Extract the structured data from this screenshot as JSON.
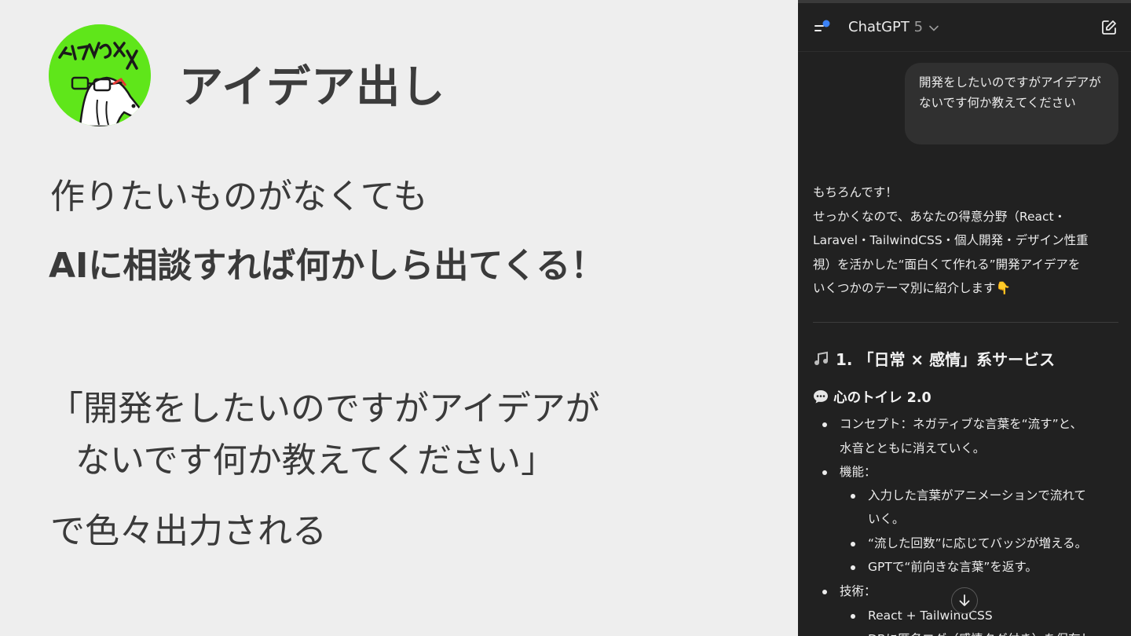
{
  "slide": {
    "title": "アイデア出し",
    "line1": "作りたいものがなくても",
    "line2": "AIに相談すれば何かしら出てくる！",
    "quote_line1": "「開発をしたいのですがアイデアが",
    "quote_line2": "ないです何か教えてください」",
    "line3": "で色々出力される",
    "avatar_icon": "horse-mascot-avatar",
    "avatar_lettering": "ケイタMAX",
    "accent": "#5fe61a"
  },
  "chat": {
    "header": {
      "model": "ChatGPT",
      "version": "5",
      "sidebar_icon": "sidebar-toggle-icon",
      "edit_icon": "new-chat-icon"
    },
    "user_message": "開発をしたいのですがアイデアがないです何か教えてください",
    "reply_lines": [
      "もちろんです！",
      "せっかくなので、あなたの得意分野（React・",
      "Laravel・TailwindCSS・個人開発・デザイン性重",
      "視）を活かした“面白くて作れる”開発アイデアを",
      "いくつかのテーマ別に紹介します👇"
    ],
    "section_heading": "1. 「日常 × 感情」系サービス",
    "idea_title": "心のトイレ 2.0",
    "bullets": [
      "コンセプト：ネガティブな言葉を“流す”と、",
      "水音とともに消えていく。",
      "機能：",
      "入力した言葉がアニメーションで流れて",
      "いく。",
      "“流した回数”に応じてバッジが増える。",
      "GPTで“前向きな言葉”を返す。",
      "技術：",
      "React + TailwindCSS",
      "DBに匿名ログ（感情タグ付き）を保存し"
    ],
    "colors": {
      "bg": "#212121",
      "bubble": "#303030",
      "badge_dot": "#3b82f6"
    }
  }
}
